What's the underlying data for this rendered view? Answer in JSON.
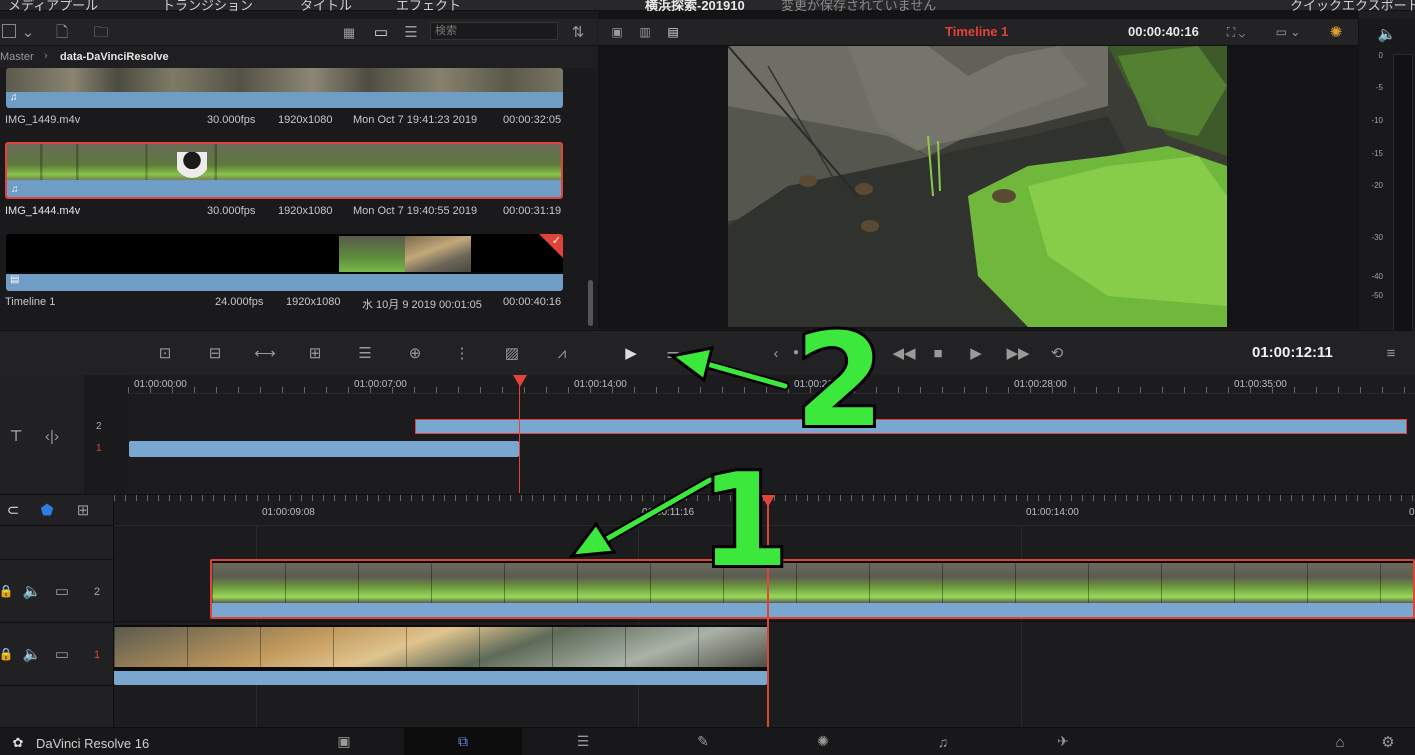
{
  "top": {
    "tab_media_pool": "メディアプール",
    "tab_transitions": "トランジション",
    "tab_titles": "タイトル",
    "tab_effects": "エフェクト",
    "project_title": "横浜探索-201910",
    "save_status": "変更が保存されていません",
    "quick_export": "クイックエクスポート"
  },
  "media_pool": {
    "search_placeholder": "検索",
    "breadcrumb_root": "Master",
    "breadcrumb_folder": "data-DaVinciResolve",
    "clips": [
      {
        "name": "IMG_1449.m4v",
        "fps": "30.000fps",
        "resolution": "1920x1080",
        "date": "Mon Oct  7 19:41:23 2019",
        "duration": "00:00:32:05"
      },
      {
        "name": "IMG_1444.m4v",
        "fps": "30.000fps",
        "resolution": "1920x1080",
        "date": "Mon Oct  7 19:40:55 2019",
        "duration": "00:00:31:19"
      },
      {
        "name": "Timeline 1",
        "fps": "24.000fps",
        "resolution": "1920x1080",
        "date": "水 10月 9 2019 00:01:05",
        "duration": "00:00:40:16"
      }
    ]
  },
  "viewer": {
    "timeline_name": "Timeline 1",
    "duration": "00:00:40:16",
    "timecode": "01:00:12:11",
    "meter_labels": [
      "0",
      "-5",
      "-10",
      "-15",
      "-20",
      "-30",
      "-40",
      "-50"
    ]
  },
  "upper_timeline": {
    "ruler": [
      "01:00:00:00",
      "01:00:07:00",
      "01:00:14:00",
      "01:00:21:00",
      "01:00:28:00",
      "01:00:35:00"
    ],
    "tracks": [
      "2",
      "1"
    ]
  },
  "lower_timeline": {
    "ruler": [
      "01:00:09:08",
      "01:00:11:16",
      "01:00:14:00",
      "0"
    ],
    "tracks": [
      "2",
      "1"
    ]
  },
  "bottom": {
    "app_name": "DaVinci Resolve 16"
  },
  "annotations": {
    "one": "1",
    "two": "2"
  },
  "colors": {
    "accent_red": "#e0433a",
    "clip_blue": "#7aa7d0",
    "annotation_green": "#3ce83c"
  }
}
